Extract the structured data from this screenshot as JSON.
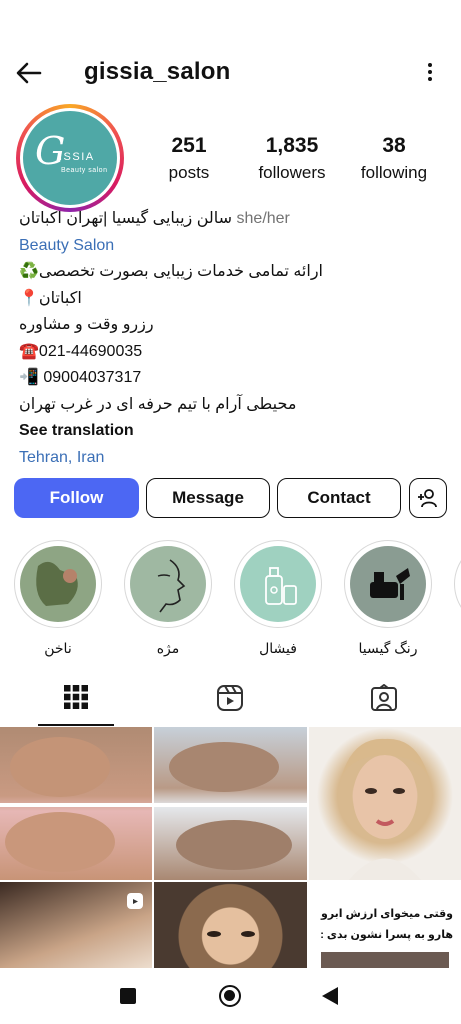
{
  "header": {
    "username": "gissia_salon",
    "back_icon": "arrow-left-icon",
    "menu_icon": "more-vertical-icon"
  },
  "avatar": {
    "logo_letter": "G",
    "logo_name": "ISSIA",
    "logo_sub": "Beauty salon",
    "bg_color": "#4fa8a6"
  },
  "stats": {
    "posts": {
      "value": "251",
      "label": "posts"
    },
    "followers": {
      "value": "1,835",
      "label": "followers"
    },
    "following": {
      "value": "38",
      "label": "following"
    }
  },
  "bio": {
    "name": "سالن زیبایی گیسیا |تهران اکباتان",
    "pronouns": "she/her",
    "category": "Beauty Salon",
    "lines": [
      "ارائه تمامی خدمات زیبایی بصورت تخصصی♻️",
      "اکباتان📍",
      "رزرو وقت و مشاوره",
      "☎️021-44690035",
      "📲 09004037317",
      "محیطی آرام با تیم حرفه ای در غرب تهران"
    ],
    "see_translation": "See translation",
    "location": "Tehran, Iran"
  },
  "actions": {
    "follow": "Follow",
    "message": "Message",
    "contact": "Contact",
    "add_user_icon": "add-user-icon"
  },
  "highlights": [
    {
      "label": "ناخن"
    },
    {
      "label": "مژه"
    },
    {
      "label": "فیشال"
    },
    {
      "label": "رنگ گیسیا"
    }
  ],
  "tabs": {
    "grid_icon": "grid-icon",
    "reels_icon": "reels-icon",
    "tagged_icon": "tagged-icon"
  },
  "posts": {
    "caption_6": "وقتی میخوای ارزش ابرو هارو به پسرا نشون بدی :"
  },
  "colors": {
    "accent": "#4c67f3",
    "link": "#3b6fb6",
    "muted": "#737373"
  }
}
